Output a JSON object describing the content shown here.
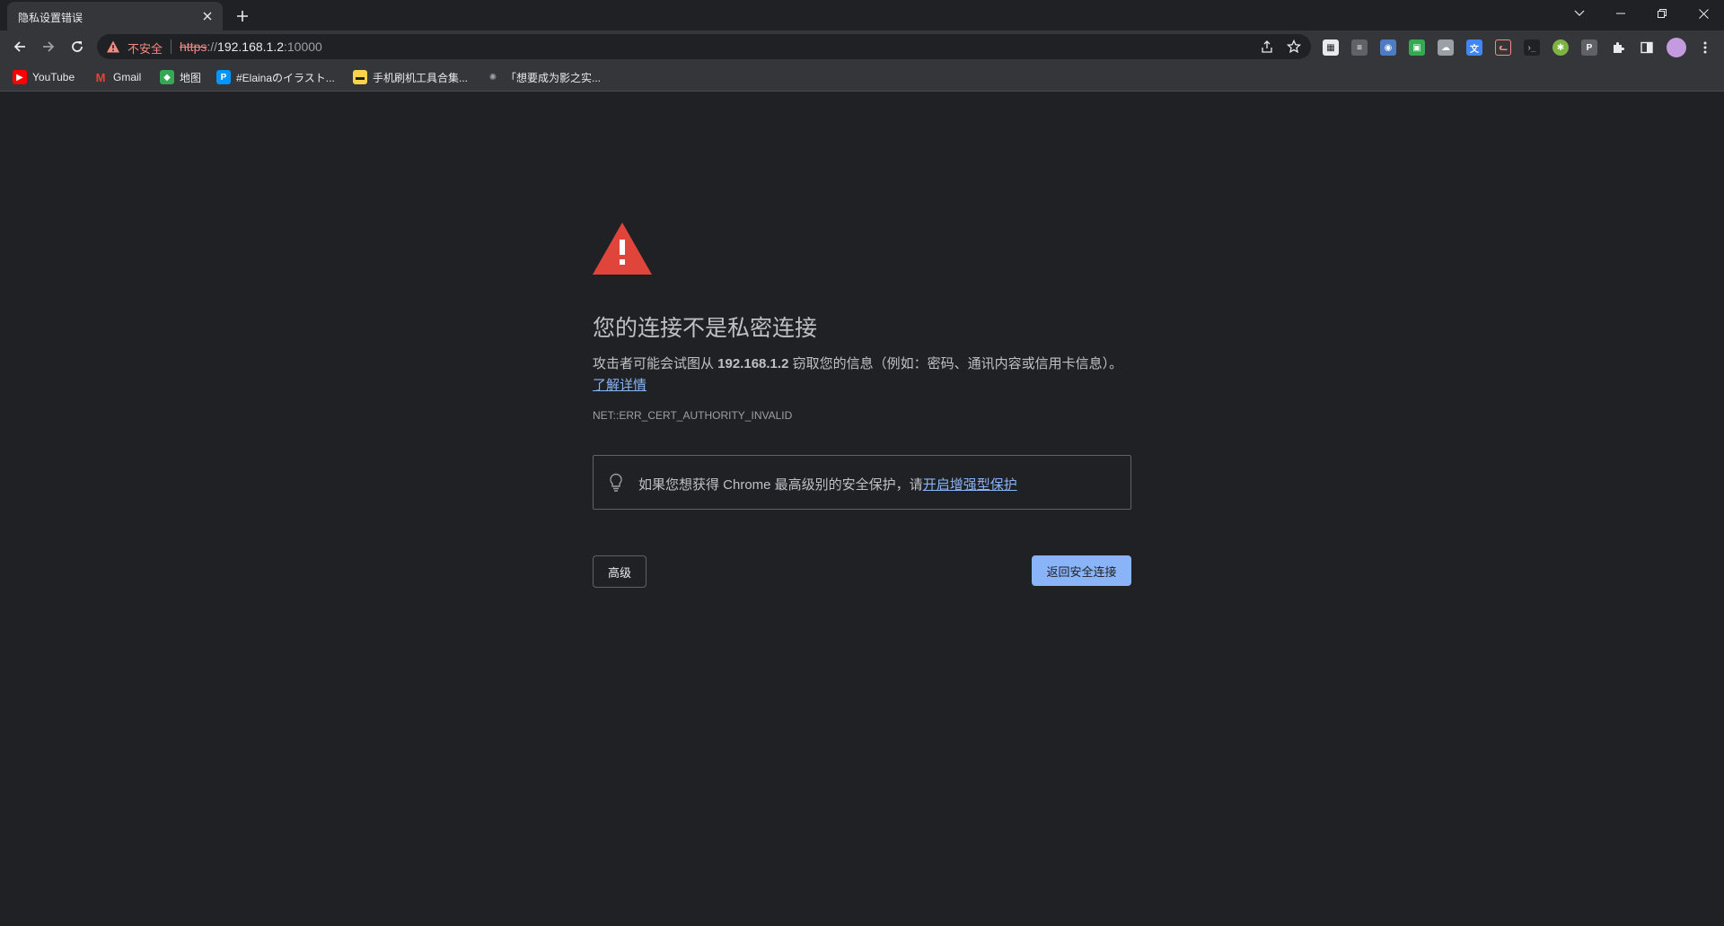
{
  "tab": {
    "title": "隐私设置错误"
  },
  "omnibox": {
    "security_label": "不安全",
    "scheme": "https",
    "separator": "://",
    "host": "192.168.1.2",
    "port": ":10000"
  },
  "bookmarks": [
    {
      "label": "YouTube",
      "icon": "youtube-icon",
      "color": "#ff0000"
    },
    {
      "label": "Gmail",
      "icon": "gmail-icon",
      "color": "#ea4335"
    },
    {
      "label": "地图",
      "icon": "maps-icon",
      "color": "#34a853"
    },
    {
      "label": "#Elainaのイラスト...",
      "icon": "pixiv-icon",
      "color": "#0096fa"
    },
    {
      "label": "手机刷机工具合集...",
      "icon": "folder-icon",
      "color": "#f9d34b"
    },
    {
      "label": "「想要成为影之实...",
      "icon": "page-icon",
      "color": "#9aa0a6"
    }
  ],
  "page": {
    "heading": "您的连接不是私密连接",
    "desc_prefix": "攻击者可能会试图从 ",
    "desc_host": "192.168.1.2",
    "desc_suffix": " 窃取您的信息（例如：密码、通讯内容或信用卡信息）。",
    "learn_more": "了解详情",
    "error_code": "NET::ERR_CERT_AUTHORITY_INVALID",
    "tip_text": "如果您想获得 Chrome 最高级别的安全保护，请",
    "tip_link": "开启增强型保护",
    "advanced_button": "高级",
    "back_button": "返回安全连接"
  },
  "colors": {
    "background": "#202124",
    "warning_red": "#e0453b",
    "accent_blue": "#8ab4f8"
  }
}
